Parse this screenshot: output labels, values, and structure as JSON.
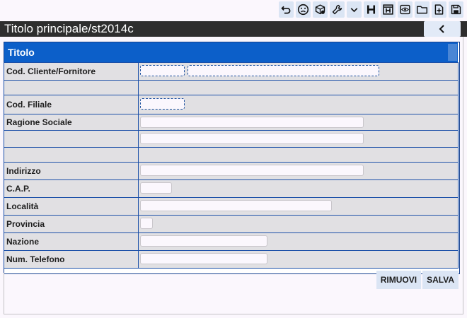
{
  "toolbar": {
    "icons": [
      "undo-icon",
      "sad-face-icon",
      "package-settings-icon",
      "wrench-icon",
      "chevron-down-icon",
      "h-bold-icon",
      "h-box-icon",
      "eye-icon",
      "folder-icon",
      "new-file-icon",
      "save-disk-icon"
    ]
  },
  "titlebar": {
    "title": "Titolo principale/st2014c",
    "back_icon": "chevron-left-icon"
  },
  "section": {
    "header": "Titolo"
  },
  "form": {
    "rows": [
      {
        "label": "Cod. Cliente/Fornitore"
      },
      {
        "label": ""
      },
      {
        "label": "Cod. Filiale"
      },
      {
        "label": "Ragione Sociale"
      },
      {
        "label": ""
      },
      {
        "label": ""
      },
      {
        "label": "Indirizzo"
      },
      {
        "label": "C.A.P."
      },
      {
        "label": "Località"
      },
      {
        "label": "Provincia"
      },
      {
        "label": "Nazione"
      },
      {
        "label": "Num. Telefono"
      }
    ],
    "values": {
      "cod_cliente": "",
      "cod_cliente_desc": "",
      "cod_filiale": "",
      "ragione_sociale_1": "",
      "ragione_sociale_2": "",
      "indirizzo": "",
      "cap": "",
      "localita": "",
      "provincia": "",
      "nazione": "",
      "telefono": ""
    }
  },
  "actions": {
    "remove_label": "RIMUOVI",
    "save_label": "SALVA"
  },
  "colors": {
    "header_blue": "#0c5fc9",
    "titlebar": "#2e2e2e",
    "grid_border": "#1b4fa8",
    "button_bg": "#dbe5f4"
  }
}
